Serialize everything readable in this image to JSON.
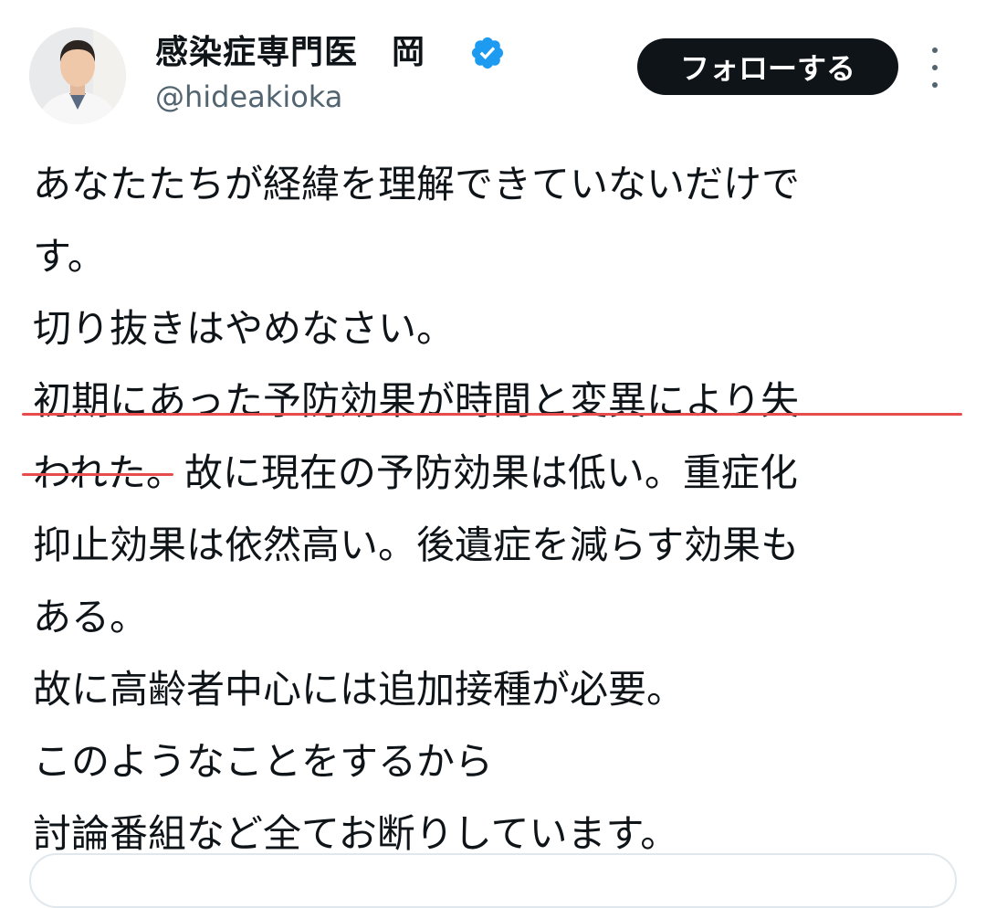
{
  "author": {
    "display_name": "感染症専門医　岡",
    "handle": "@hideakioka",
    "verified": true
  },
  "actions": {
    "follow_label": "フォローする",
    "more_icon": "more-vertical-icon"
  },
  "tweet": {
    "lines": [
      "あなたたちが経緯を理解できていないだけで",
      "す。",
      "切り抜きはやめなさい。",
      "初期にあった予防効果が時間と変異により失",
      "われた。故に現在の予防効果は低い。重症化",
      "抑止効果は依然高い。後遺症を減らす効果も",
      "ある。",
      "故に高齢者中心には追加接種が必要。",
      "このようなことをするから",
      "討論番組など全てお断りしています。"
    ]
  },
  "colors": {
    "text": "#0f1419",
    "secondary": "#536471",
    "follow_bg": "#0f1419",
    "verified": "#1d9bf0",
    "annotation_underline": "#e74c4c"
  }
}
